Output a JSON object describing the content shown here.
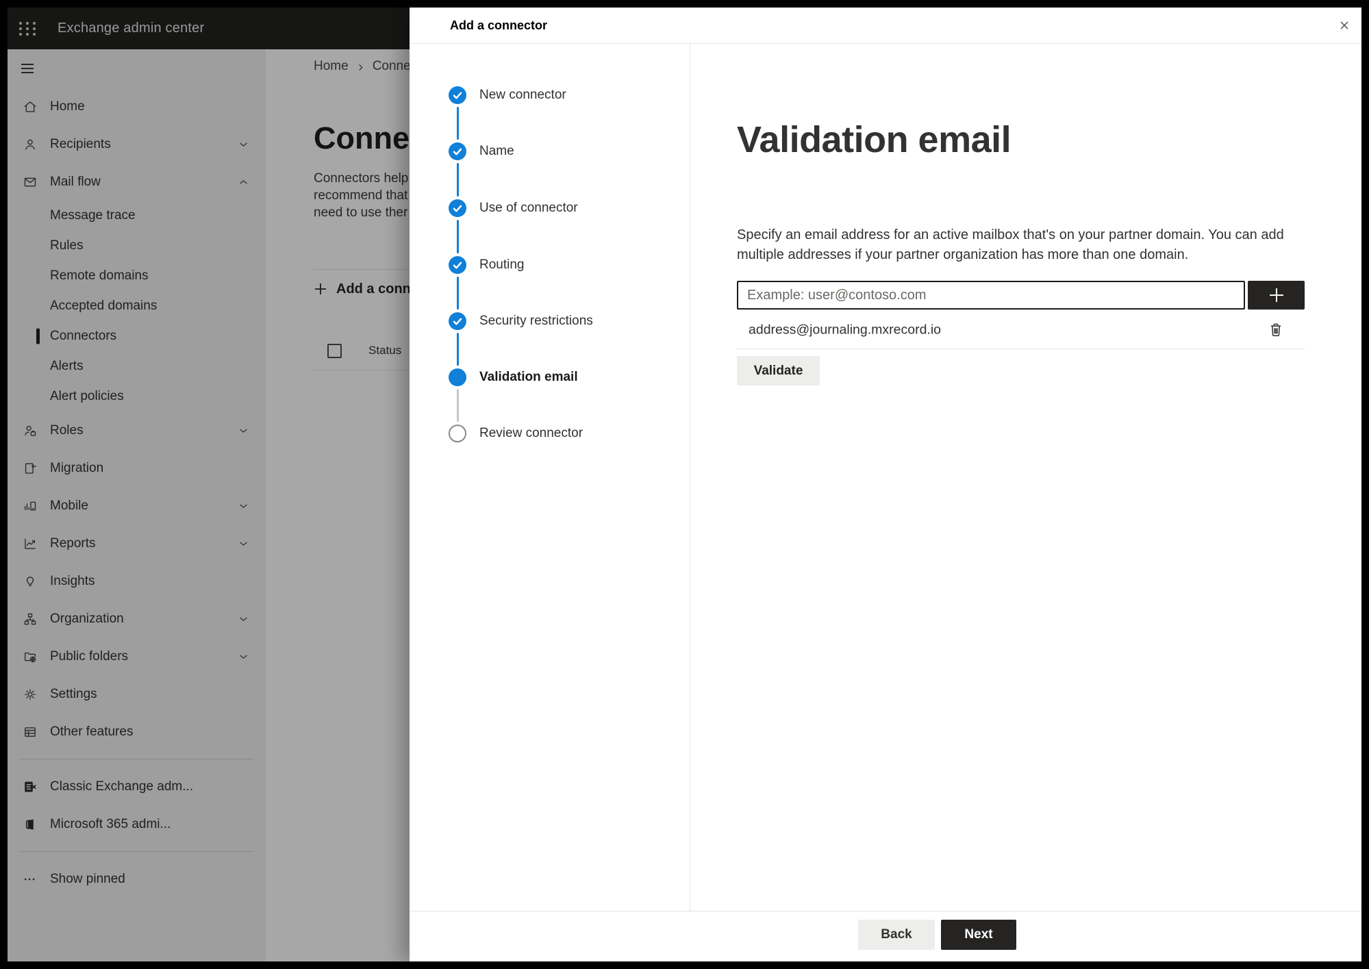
{
  "app": {
    "topbar": {
      "title": "Exchange admin center"
    },
    "sidebar": {
      "items": [
        {
          "label": "Home",
          "icon": "home"
        },
        {
          "label": "Recipients",
          "icon": "recipients",
          "chevron": "down"
        },
        {
          "label": "Mail flow",
          "icon": "mail-flow",
          "chevron": "up"
        },
        {
          "label": "Message trace",
          "sub": true
        },
        {
          "label": "Rules",
          "sub": true
        },
        {
          "label": "Remote domains",
          "sub": true
        },
        {
          "label": "Accepted domains",
          "sub": true
        },
        {
          "label": "Connectors",
          "sub": true,
          "selected": true
        },
        {
          "label": "Alerts",
          "sub": true
        },
        {
          "label": "Alert policies",
          "sub": true
        },
        {
          "label": "Roles",
          "icon": "roles",
          "chevron": "down"
        },
        {
          "label": "Migration",
          "icon": "migration"
        },
        {
          "label": "Mobile",
          "icon": "mobile",
          "chevron": "down"
        },
        {
          "label": "Reports",
          "icon": "reports",
          "chevron": "down"
        },
        {
          "label": "Insights",
          "icon": "insights"
        },
        {
          "label": "Organization",
          "icon": "organization",
          "chevron": "down"
        },
        {
          "label": "Public folders",
          "icon": "public-folders",
          "chevron": "down"
        },
        {
          "label": "Settings",
          "icon": "settings"
        },
        {
          "label": "Other features",
          "icon": "other-features"
        },
        {
          "divider": true
        },
        {
          "label": "Classic Exchange adm...",
          "icon": "classic-exchange"
        },
        {
          "label": "Microsoft 365 admi...",
          "icon": "m365"
        },
        {
          "divider": true
        },
        {
          "label": "Show pinned",
          "icon": "more"
        }
      ]
    },
    "page": {
      "breadcrumb_home": "Home",
      "breadcrumb_current": "Conne",
      "title": "Connec",
      "description_lines": [
        "Connectors help",
        "recommend that",
        "need to use ther"
      ],
      "add_button_label": "Add a conn",
      "status_header": "Status"
    }
  },
  "dialog": {
    "title": "Add a connector",
    "close_label": "Close",
    "steps": [
      {
        "label": "New connector",
        "state": "done"
      },
      {
        "label": "Name",
        "state": "done"
      },
      {
        "label": "Use of connector",
        "state": "done"
      },
      {
        "label": "Routing",
        "state": "done"
      },
      {
        "label": "Security restrictions",
        "state": "done"
      },
      {
        "label": "Validation email",
        "state": "current"
      },
      {
        "label": "Review connector",
        "state": "upcoming"
      }
    ],
    "content": {
      "heading": "Validation email",
      "desc_line1": "Specify an email address for an active mailbox that's on your partner domain. You can add",
      "desc_line2": "multiple addresses if your partner organization has more than one domain.",
      "email_placeholder": "Example: user@contoso.com",
      "addresses": [
        "address@journaling.mxrecord.io"
      ],
      "validate_label": "Validate"
    },
    "footer": {
      "back_label": "Back",
      "next_label": "Next"
    },
    "colors": {
      "accent": "#1080d8",
      "upcoming_ring": "#8a8886",
      "pending_line": "#c8c6c4",
      "dark_button": "#252423",
      "light_button": "#ededec"
    }
  }
}
